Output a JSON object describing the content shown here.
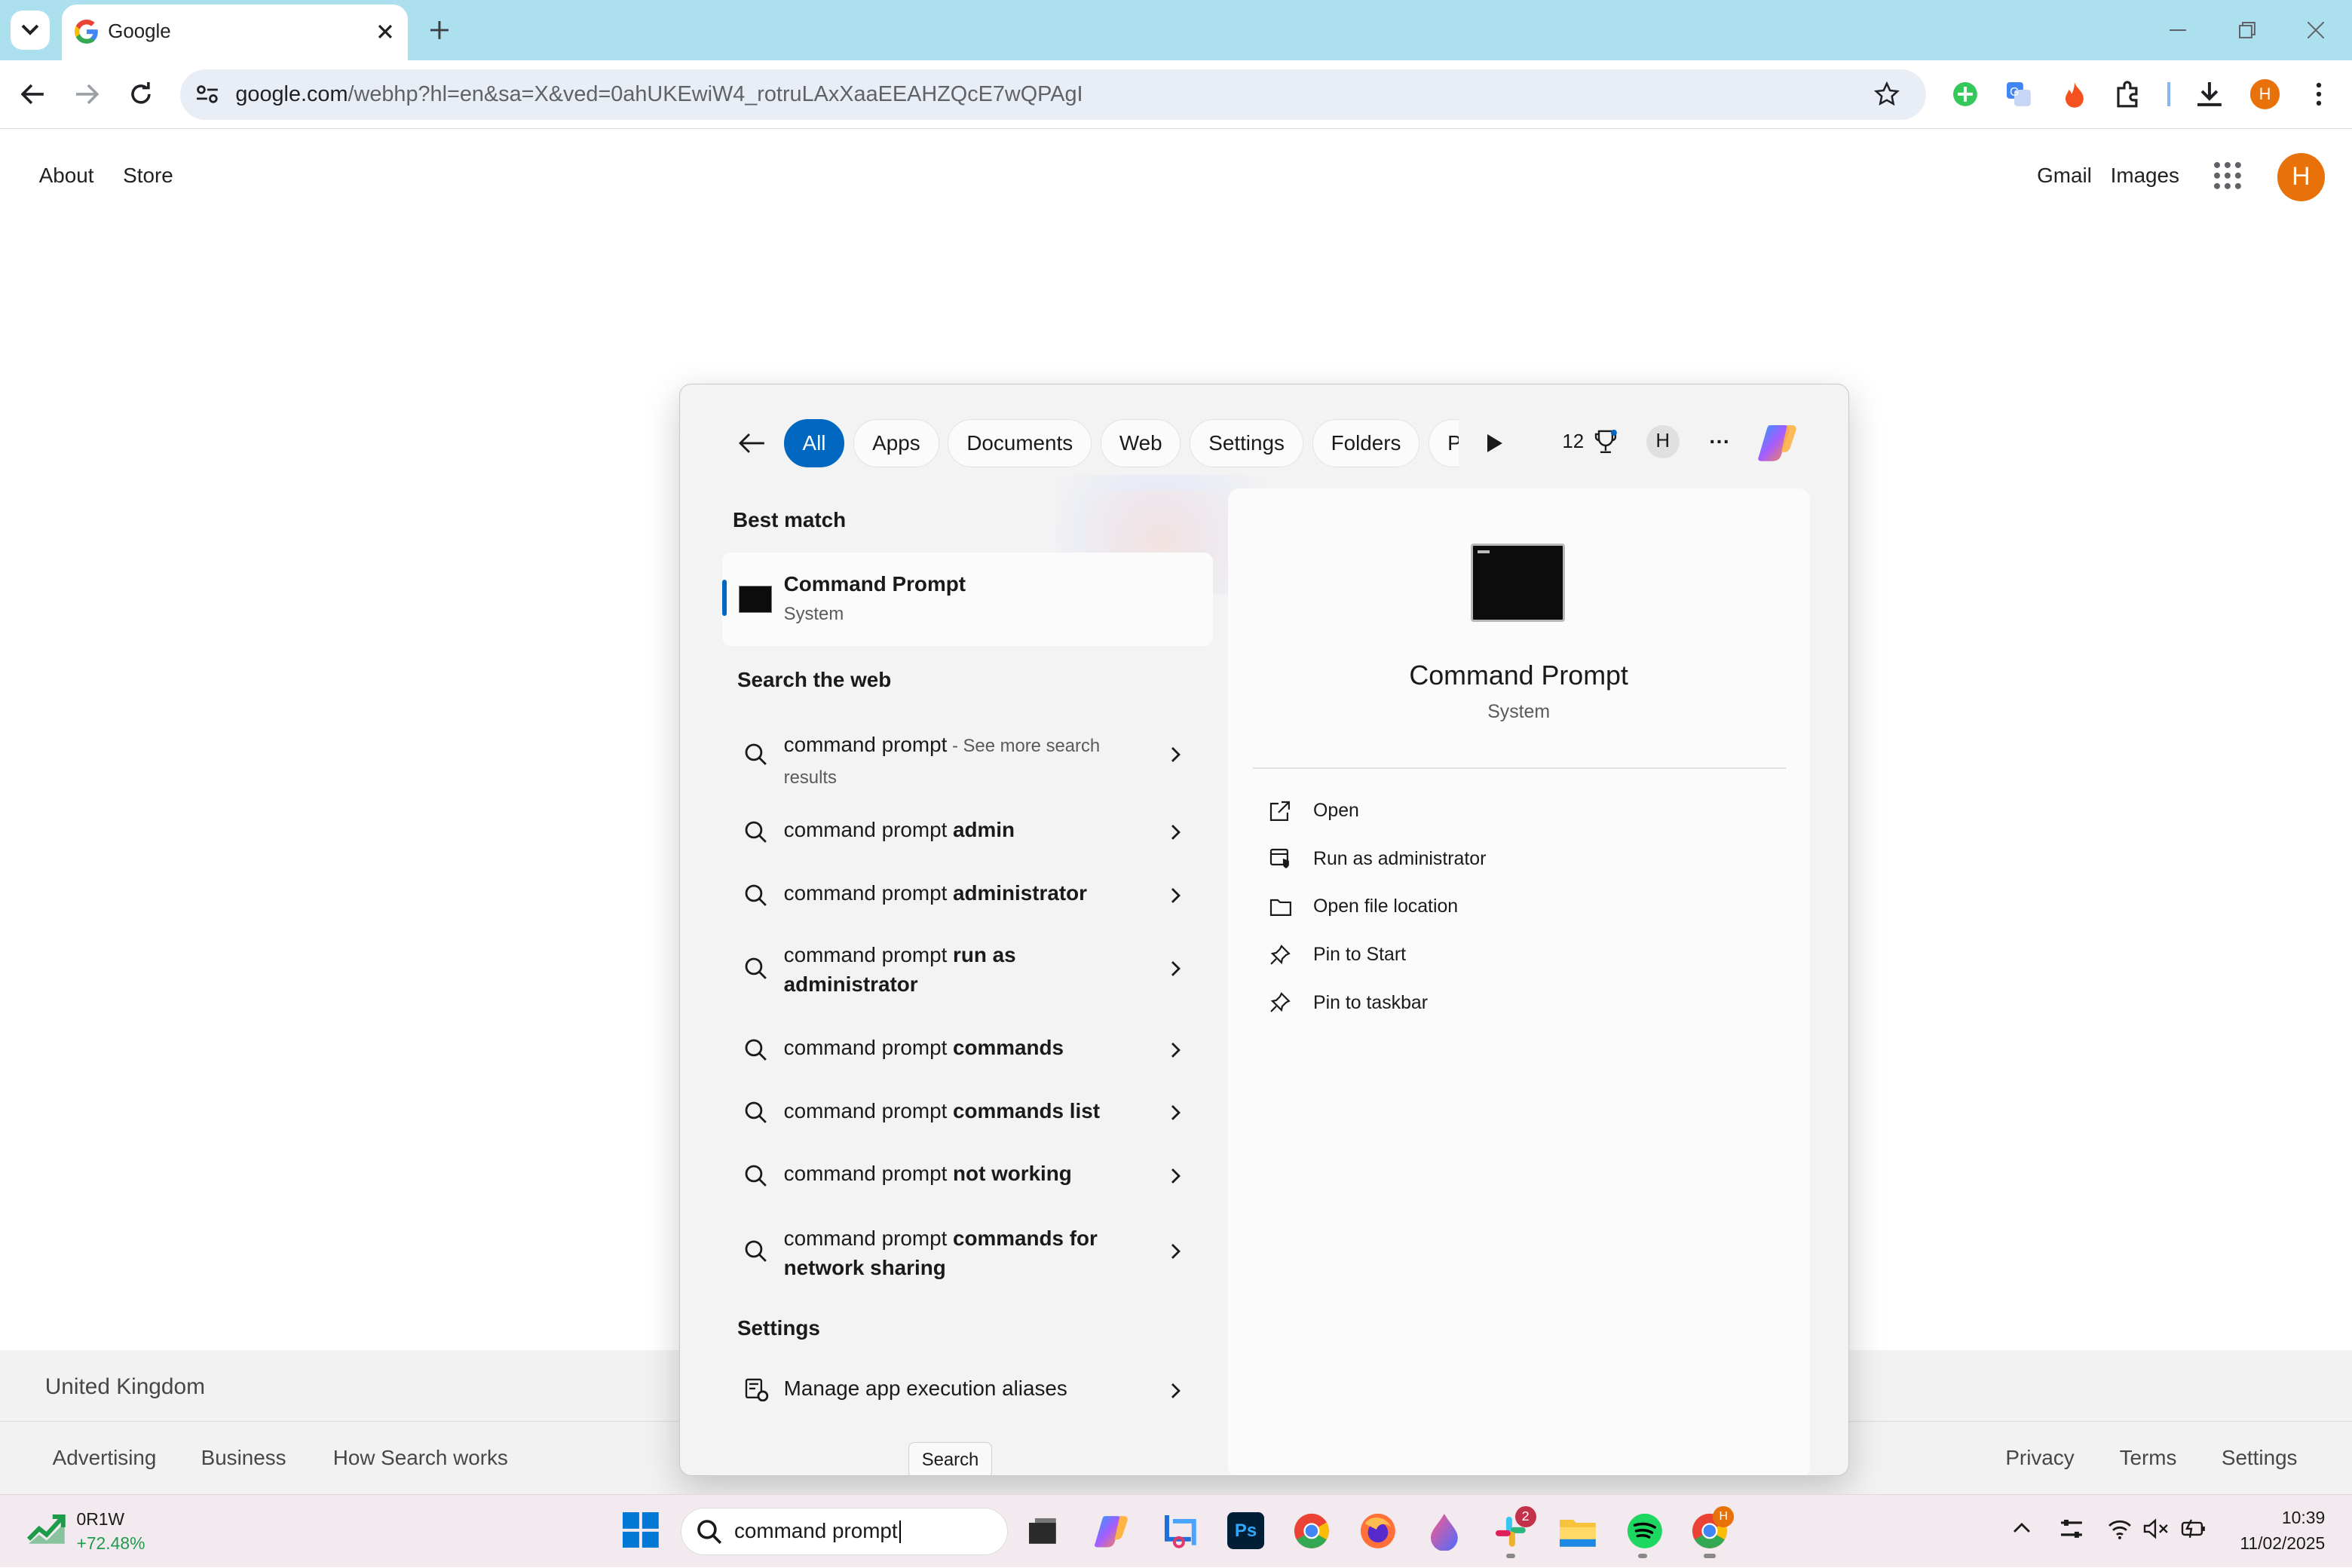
{
  "browser": {
    "tab_title": "Google",
    "url_host": "google.com",
    "url_path": "/webhp?hl=en&sa=X&ved=0ahUKEwiW4_rotruLAxXaaEEAHZQcE7wQPAgI",
    "profile_initial": "H"
  },
  "google": {
    "nav_left": [
      "About",
      "Store"
    ],
    "nav_right": [
      "Gmail",
      "Images"
    ],
    "avatar_initial": "H",
    "country": "United Kingdom",
    "footer_left": [
      "Advertising",
      "Business",
      "How Search works"
    ],
    "footer_right": [
      "Privacy",
      "Terms",
      "Settings"
    ]
  },
  "search_panel": {
    "filters": [
      "All",
      "Apps",
      "Documents",
      "Web",
      "Settings",
      "Folders",
      "Pho"
    ],
    "points": "12",
    "user_initial": "H",
    "more": "···",
    "best_match_heading": "Best match",
    "best_match": {
      "title": "Command Prompt",
      "subtitle": "System"
    },
    "web_heading": "Search the web",
    "web_results": [
      {
        "prefix": "command prompt",
        "bold": "",
        "suffix": " - See more search",
        "line2": "results"
      },
      {
        "prefix": "command prompt ",
        "bold": "admin"
      },
      {
        "prefix": "command prompt ",
        "bold": "administrator"
      },
      {
        "prefix": "command prompt ",
        "bold": "run as",
        "line2b": "administrator"
      },
      {
        "prefix": "command prompt ",
        "bold": "commands"
      },
      {
        "prefix": "command prompt ",
        "bold": "commands list"
      },
      {
        "prefix": "command prompt ",
        "bold": "not working"
      },
      {
        "prefix": "command prompt ",
        "bold": "commands for",
        "line2b": "network sharing"
      }
    ],
    "settings_heading": "Settings",
    "settings_item": "Manage app execution aliases",
    "detail": {
      "title": "Command Prompt",
      "subtitle": "System",
      "actions": [
        "Open",
        "Run as administrator",
        "Open file location",
        "Pin to Start",
        "Pin to taskbar"
      ]
    },
    "tooltip": "Search"
  },
  "taskbar": {
    "stock_symbol": "0R1W",
    "stock_change": "+72.48%",
    "search_text": "command prompt",
    "slack_badge": "2",
    "chrome_badge": "H",
    "time": "10:39",
    "date": "11/02/2025"
  },
  "colors": {
    "accent": "#0067c0",
    "tabbar": "#ace0ee",
    "avatar": "#e8710a"
  }
}
